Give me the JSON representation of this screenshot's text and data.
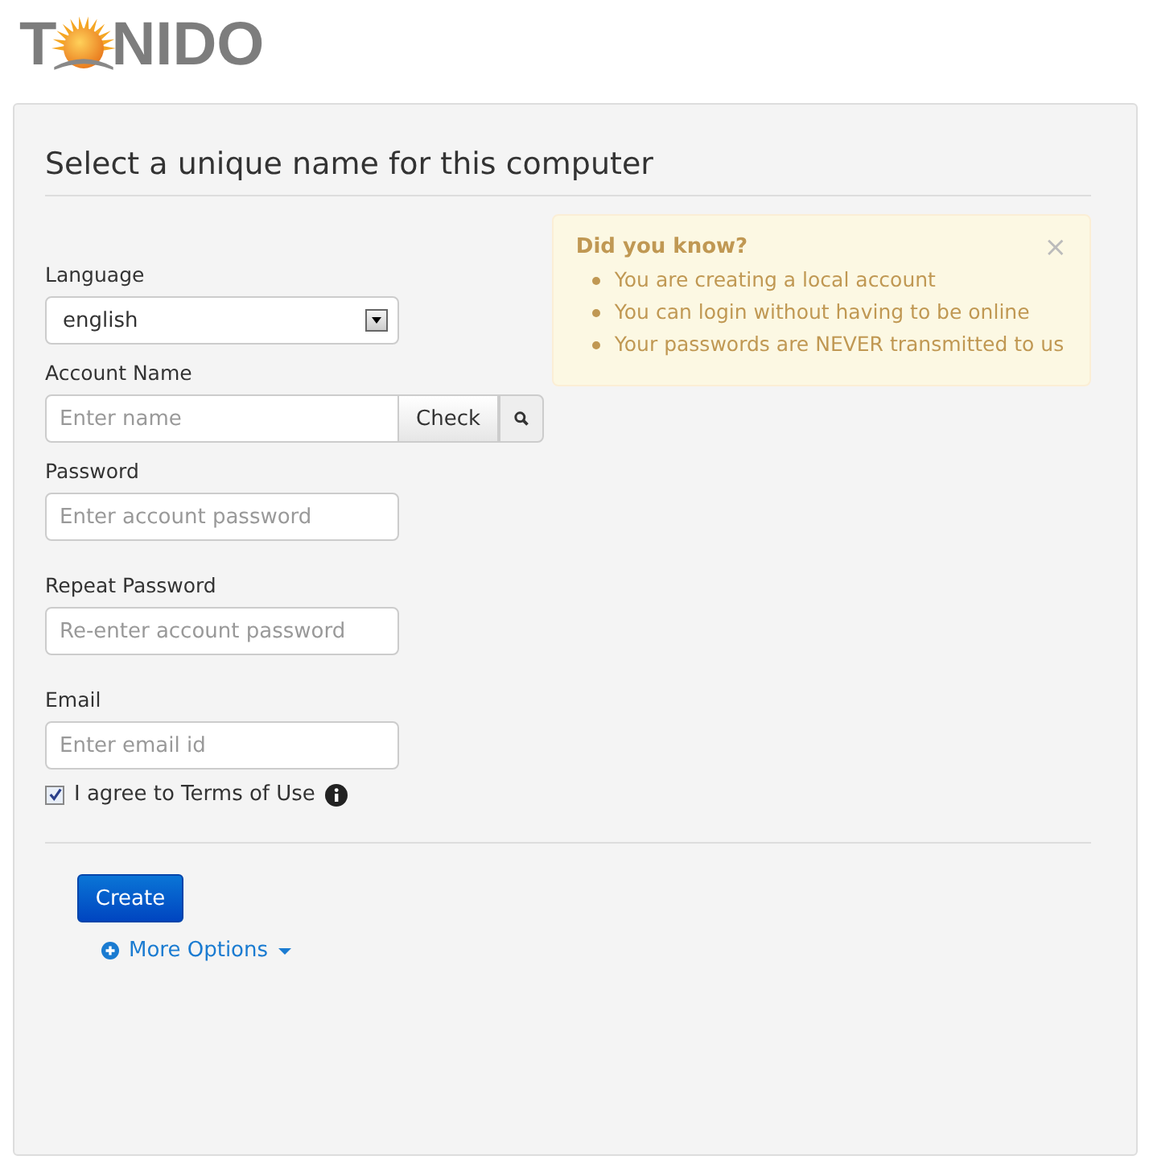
{
  "logo": {
    "before": "T",
    "after": "NIDO"
  },
  "panel": {
    "title": "Select a unique name for this computer"
  },
  "fields": [
    {
      "kind": "select",
      "label": "Language",
      "value": "english"
    },
    {
      "kind": "check",
      "label": "Account Name",
      "placeholder": "Enter name",
      "button": "Check"
    },
    {
      "kind": "input",
      "label": "Password",
      "placeholder": "Enter account password"
    },
    {
      "kind": "input",
      "label": "Repeat Password",
      "placeholder": "Re-enter account password"
    },
    {
      "kind": "input",
      "label": "Email",
      "placeholder": "Enter email id"
    }
  ],
  "agree": {
    "label": "I agree to Terms of Use",
    "checked": true
  },
  "notice": {
    "title": "Did you know?",
    "close": "×",
    "items": [
      "You are creating a local account",
      "You can login without having to be online",
      "Your passwords are NEVER transmitted to us"
    ]
  },
  "create_button": "Create",
  "more_options": "More Options"
}
